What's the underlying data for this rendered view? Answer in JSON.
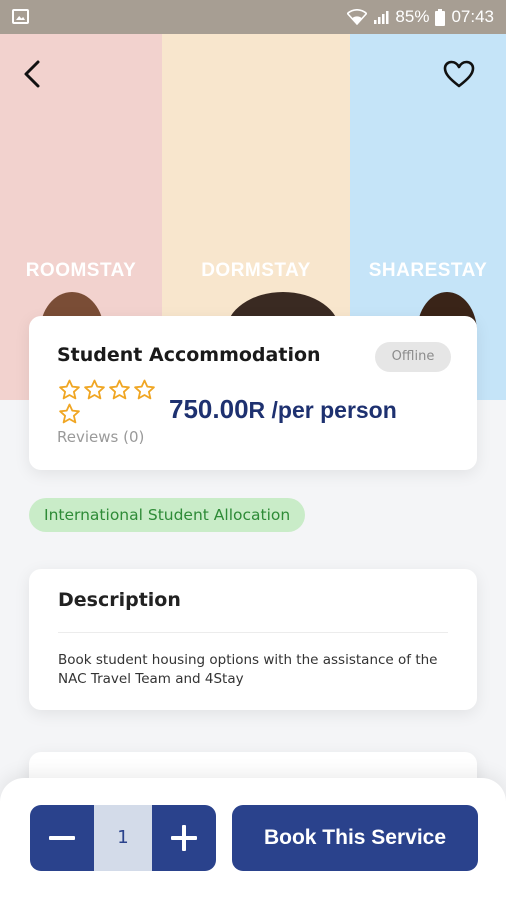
{
  "status_bar": {
    "battery": "85%",
    "time": "07:43",
    "icons": [
      "image-icon",
      "wifi-icon",
      "signal-icon",
      "battery-icon"
    ]
  },
  "hero": {
    "panels": [
      {
        "label": "ROOMSTAY",
        "color": "#f2d2ce"
      },
      {
        "label": "DORMSTAY",
        "color": "#f8e6cd"
      },
      {
        "label": "SHARESTAY",
        "color": "#c5e4f8"
      }
    ]
  },
  "nav": {
    "back_icon": "chevron-left-icon",
    "favorite_icon": "heart-icon"
  },
  "service": {
    "title": "Student Accommodation",
    "status": "Offline",
    "rating": 0,
    "max_rating": 5,
    "reviews": "Reviews (0)",
    "price_value": "750.00",
    "price_unit": "R /per person"
  },
  "tag": "International Student Allocation",
  "description": {
    "heading": "Description",
    "text": "Book student housing options with the assistance of the NAC Travel Team and 4Stay"
  },
  "booking": {
    "quantity": "1",
    "decrement_icon": "minus-icon",
    "increment_icon": "plus-icon",
    "book_label": "Book This Service"
  },
  "colors": {
    "primary": "#2a428c",
    "price": "#1e3170",
    "star": "#f0a623",
    "tag_bg": "#c9ecc8",
    "tag_text": "#2e8b37"
  }
}
